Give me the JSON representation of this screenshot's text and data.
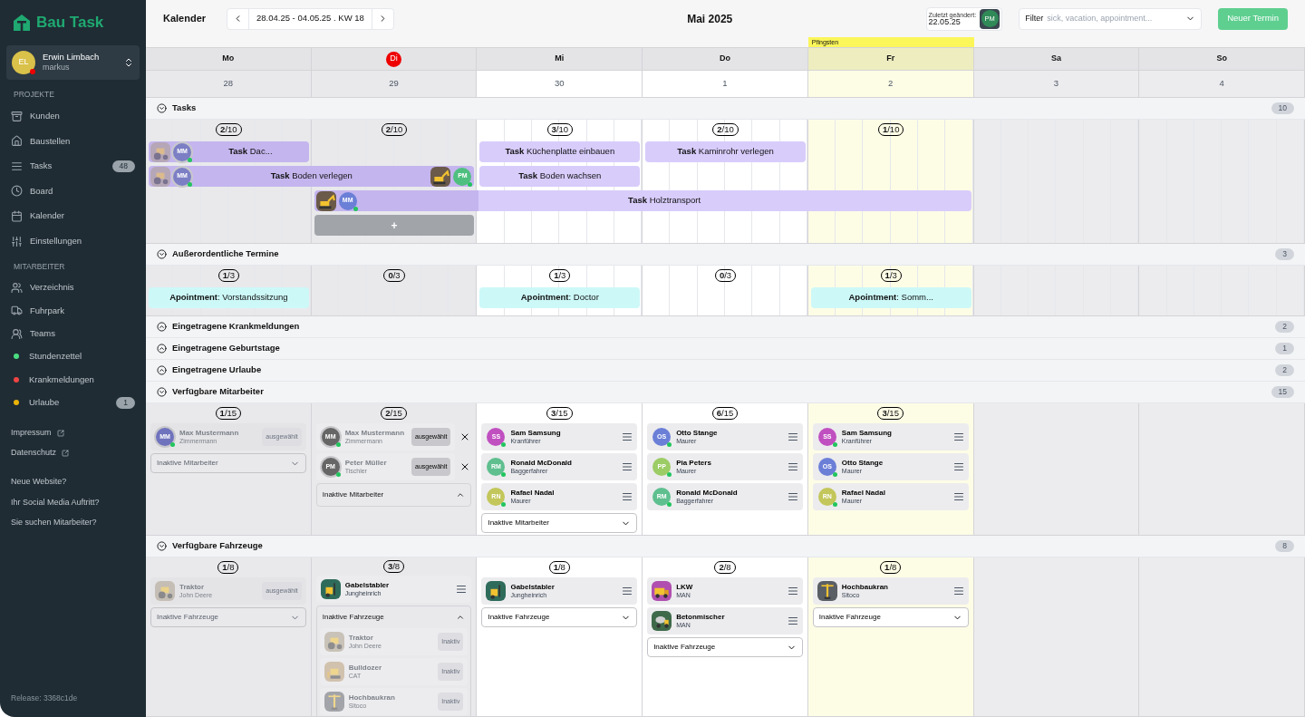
{
  "sidebar": {
    "brand": "Bau Task",
    "user": {
      "initials": "EL",
      "name": "Erwin Limbach",
      "username": "markus",
      "online": false
    },
    "groups": [
      {
        "title": "PROJEKTE",
        "items": [
          {
            "kind": "icon",
            "label": "Kunden"
          },
          {
            "kind": "icon",
            "label": "Baustellen"
          },
          {
            "kind": "icon",
            "label": "Tasks",
            "badge": "48"
          },
          {
            "kind": "icon",
            "label": "Board"
          },
          {
            "kind": "icon",
            "label": "Kalender"
          },
          {
            "kind": "icon",
            "label": "Einstellungen"
          }
        ]
      },
      {
        "title": "MITARBEITER",
        "items": [
          {
            "kind": "icon",
            "label": "Verzeichnis"
          },
          {
            "kind": "icon",
            "label": "Fuhrpark"
          },
          {
            "kind": "icon",
            "label": "Teams"
          },
          {
            "kind": "dot",
            "color": "#4ade80",
            "label": "Stundenzettel"
          },
          {
            "kind": "dot",
            "color": "#ef4444",
            "label": "Krankmeldungen"
          },
          {
            "kind": "dot",
            "color": "#eab308",
            "label": "Urlaube",
            "badge": "1"
          }
        ]
      }
    ],
    "links": [
      "Impressum",
      "Datenschutz"
    ],
    "promos": [
      "Neue Website?",
      "Ihr Social Media Auftritt?",
      "Sie suchen Mitarbeiter?"
    ],
    "release": "Release: 3368c1de"
  },
  "header": {
    "title": "Kalender",
    "range": "28.04.25 - 04.05.25 . KW 18",
    "month": "Mai 2025",
    "last_change": {
      "label": "Zuletzt geändert:",
      "date": "22.05.25",
      "initials": "PM"
    },
    "filter": {
      "label": "Filter",
      "placeholder": "sick, vacation, appointment..."
    },
    "new_button": "Neuer Termin"
  },
  "days": [
    {
      "name": "Mo",
      "date": "28",
      "kind": "past",
      "today": false
    },
    {
      "name": "Di",
      "date": "29",
      "kind": "past",
      "today": true
    },
    {
      "name": "Mi",
      "date": "30",
      "kind": "normal",
      "today": false
    },
    {
      "name": "Do",
      "date": "1",
      "kind": "normal",
      "today": false
    },
    {
      "name": "Fr",
      "date": "2",
      "kind": "holiday",
      "today": false,
      "holiday": "Pfingsten"
    },
    {
      "name": "Sa",
      "date": "3",
      "kind": "weekend",
      "today": false
    },
    {
      "name": "So",
      "date": "4",
      "kind": "weekend",
      "today": false
    }
  ],
  "sections": [
    {
      "kind": "tasks",
      "title": "Tasks",
      "count": "10",
      "expanded": true,
      "day_counts": [
        "**2**/10",
        "**2**/10",
        "**3**/10",
        "**2**/10",
        "**1**/10"
      ],
      "rows": [
        [
          {
            "kind": "bar",
            "text": "**Task** Dac...",
            "avatars_left": [
              {
                "kind": "tractor",
                "inactive": true
              },
              {
                "kind": "person",
                "initials": "MM",
                "color": "#7c7fc4",
                "inactive": true
              }
            ]
          },
          {
            "kind": "gap"
          },
          {
            "kind": "bar",
            "text": "**Task** Küchenplatte einbauen"
          },
          {
            "kind": "bar",
            "text": "**Task** Kaminrohr verlegen"
          }
        ],
        [
          {
            "kind": "bar",
            "text": "**Task** Boden verlegen",
            "avatars_left": [
              {
                "kind": "tractor",
                "inactive": true
              },
              {
                "kind": "person",
                "initials": "MM",
                "color": "#7c7fc4",
                "inactive": true
              }
            ],
            "avatars_right": [
              {
                "kind": "excavator",
                "inactive": false
              },
              {
                "kind": "person",
                "initials": "PM",
                "color": "#4fbf7f",
                "inactive": false
              }
            ]
          },
          {
            "kind": "continuation"
          },
          {
            "kind": "bar",
            "text": "**Task** Boden wachsen"
          }
        ],
        [
          {
            "kind": "gap"
          },
          {
            "kind": "bar",
            "text": "**Task** Holztransport",
            "avatars_left": [
              {
                "kind": "excavator",
                "inactive": false
              },
              {
                "kind": "person",
                "initials": "MM",
                "color": "#6b7fd7",
                "inactive": false
              }
            ]
          },
          {
            "kind": "continuation"
          },
          {
            "kind": "continuation"
          },
          {
            "kind": "continuation"
          }
        ],
        [
          {
            "kind": "gap"
          },
          {
            "kind": "add",
            "text": "+"
          }
        ]
      ]
    },
    {
      "kind": "appointments",
      "title": "Außerordentliche Termine",
      "count": "3",
      "expanded": true,
      "day_counts": [
        "**1**/3",
        "**0**/3",
        "**1**/3",
        "**0**/3",
        "**1**/3"
      ],
      "rows": [
        [
          {
            "kind": "bar",
            "text": "**Apointment**: Vorstandssitzung"
          },
          {
            "kind": "gap"
          },
          {
            "kind": "bar",
            "text": "**Apointment**: Doctor"
          },
          {
            "kind": "gap"
          },
          {
            "kind": "bar",
            "text": "**Apointment**: Somm..."
          }
        ]
      ]
    },
    {
      "kind": "entries",
      "title": "Eingetragene Krankmeldungen",
      "count": "2",
      "expanded": false
    },
    {
      "kind": "entries",
      "title": "Eingetragene Geburtstage",
      "count": "1",
      "expanded": false
    },
    {
      "kind": "entries",
      "title": "Eingetragene Urlaube",
      "count": "2",
      "expanded": false
    },
    {
      "kind": "resources",
      "title": "Verfügbare Mitarbeiter",
      "count": "15",
      "expanded": true,
      "columns": [
        {
          "count": "**1**/15",
          "items": [
            {
              "kind": "locked",
              "avatar": {
                "kind": "person",
                "initials": "MM",
                "color": "#6f73bd"
              },
              "name": "Max Mustermann",
              "role": "Zimmermann",
              "action": "ausgewählt"
            }
          ],
          "inactive": {
            "label": "Inaktive Mitarbeiter",
            "expanded": false
          }
        },
        {
          "count": "**2**/15",
          "items": [
            {
              "kind": "picked",
              "avatar": {
                "kind": "person",
                "initials": "MM",
                "color": "#666666"
              },
              "name": "Max Mustermann",
              "role": "Zimmermann",
              "action": "ausgewählt"
            },
            {
              "kind": "picked",
              "avatar": {
                "kind": "person",
                "initials": "PM",
                "color": "#666666"
              },
              "name": "Peter Müller",
              "role": "Tischler",
              "action": "ausgewählt"
            }
          ],
          "inactive": {
            "label": "Inaktive Mitarbeiter",
            "expanded": true
          }
        },
        {
          "count": "**3**/15",
          "items": [
            {
              "kind": "assigned",
              "avatar": {
                "kind": "person",
                "initials": "SS",
                "color": "#c04fc0"
              },
              "name": "Sam Samsung",
              "role": "Kranführer"
            },
            {
              "kind": "assigned",
              "avatar": {
                "kind": "person",
                "initials": "RM",
                "color": "#5fbf8f"
              },
              "name": "Ronald McDonald",
              "role": "Baggerfahrer"
            },
            {
              "kind": "assigned",
              "avatar": {
                "kind": "person",
                "initials": "RN",
                "color": "#c3c65a"
              },
              "name": "Rafael Nadal",
              "role": "Maurer"
            }
          ],
          "inactive": {
            "label": "Inaktive Mitarbeiter",
            "expanded": false
          }
        },
        {
          "count": "**6**/15",
          "items": [
            {
              "kind": "assigned",
              "avatar": {
                "kind": "person",
                "initials": "OS",
                "color": "#6b7fd7"
              },
              "name": "Otto Stange",
              "role": "Maurer"
            },
            {
              "kind": "assigned",
              "avatar": {
                "kind": "person",
                "initials": "PP",
                "color": "#9ccc65"
              },
              "name": "Pia Peters",
              "role": "Maurer"
            },
            {
              "kind": "assigned",
              "avatar": {
                "kind": "person",
                "initials": "RM",
                "color": "#5fbf8f"
              },
              "name": "Ronald McDonald",
              "role": "Baggerfahrer"
            }
          ]
        },
        {
          "count": "**3**/15",
          "items": [
            {
              "kind": "assigned",
              "avatar": {
                "kind": "person",
                "initials": "SS",
                "color": "#c04fc0"
              },
              "name": "Sam Samsung",
              "role": "Kranführer"
            },
            {
              "kind": "assigned",
              "avatar": {
                "kind": "person",
                "initials": "OS",
                "color": "#6b7fd7"
              },
              "name": "Otto Stange",
              "role": "Maurer"
            },
            {
              "kind": "assigned",
              "avatar": {
                "kind": "person",
                "initials": "RN",
                "color": "#c3c65a"
              },
              "name": "Rafael Nadal",
              "role": "Maurer"
            }
          ]
        }
      ]
    },
    {
      "kind": "resources",
      "title": "Verfügbare Fahrzeuge",
      "count": "8",
      "expanded": true,
      "columns": [
        {
          "count": "**1**/8",
          "items": [
            {
              "kind": "locked",
              "avatar": {
                "kind": "tractor"
              },
              "name": "Traktor",
              "role": "John Deere",
              "action": "ausgewählt"
            }
          ],
          "inactive": {
            "label": "Inaktive Fahrzeuge",
            "expanded": false
          }
        },
        {
          "count": "**3**/8",
          "items": [
            {
              "kind": "assigned",
              "avatar": {
                "kind": "forklift"
              },
              "name": "Gabelstabler",
              "role": "Jungheinrich"
            }
          ],
          "inactive": {
            "label": "Inaktive Fahrzeuge",
            "expanded": true,
            "items": [
              {
                "kind": "inactive",
                "avatar": {
                  "kind": "tractor"
                },
                "name": "Traktor",
                "role": "John Deere",
                "action": "Inaktiv"
              },
              {
                "kind": "inactive",
                "avatar": {
                  "kind": "bulldozer"
                },
                "name": "Bulldozer",
                "role": "CAT",
                "action": "Inaktiv"
              },
              {
                "kind": "inactive",
                "avatar": {
                  "kind": "crane"
                },
                "name": "Hochbaukran",
                "role": "Sitoco",
                "action": "Inaktiv"
              }
            ]
          }
        },
        {
          "count": "**1**/8",
          "items": [
            {
              "kind": "assigned",
              "avatar": {
                "kind": "forklift"
              },
              "name": "Gabelstabler",
              "role": "Jungheinrich"
            }
          ],
          "inactive": {
            "label": "Inaktive Fahrzeuge",
            "expanded": false
          }
        },
        {
          "count": "**2**/8",
          "items": [
            {
              "kind": "assigned",
              "avatar": {
                "kind": "truck"
              },
              "name": "LKW",
              "role": "MAN"
            },
            {
              "kind": "assigned",
              "avatar": {
                "kind": "mixer"
              },
              "name": "Betonmischer",
              "role": "MAN"
            }
          ],
          "inactive": {
            "label": "Inaktive Fahrzeuge",
            "expanded": false
          }
        },
        {
          "count": "**1**/8",
          "items": [
            {
              "kind": "assigned",
              "avatar": {
                "kind": "crane"
              },
              "name": "Hochbaukran",
              "role": "Sitoco"
            }
          ],
          "inactive": {
            "label": "Inaktive Fahrzeuge",
            "expanded": false
          }
        }
      ]
    }
  ]
}
